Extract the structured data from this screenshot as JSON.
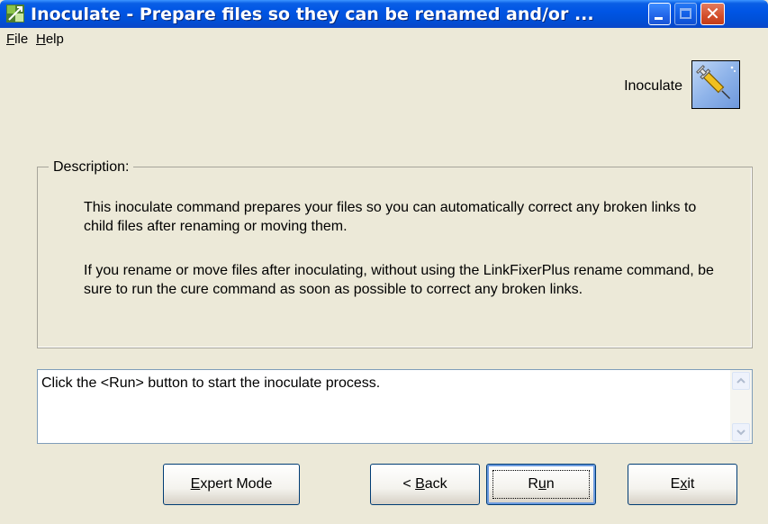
{
  "window": {
    "title": "Inoculate - Prepare files so they can be renamed and/or ...",
    "app_icon": "linkfixer-app-icon",
    "controls": [
      "minimize-icon",
      "maximize-icon",
      "close-icon"
    ],
    "close_glyph": "✕",
    "colors": {
      "titlebar": "#0055E5",
      "close": "#D34E2A",
      "face": "#ECE9D8"
    }
  },
  "menu": {
    "file": {
      "accel": "F",
      "rest": "ile"
    },
    "help": {
      "accel": "H",
      "rest": "elp"
    }
  },
  "header": {
    "label": "Inoculate",
    "icon": "syringe-icon"
  },
  "description": {
    "legend": "Description:",
    "paragraph1": "This inoculate command prepares your files so you can automatically correct any broken links to child files after renaming or moving them.",
    "paragraph2": "If you rename or move files after inoculating, without using the LinkFixerPlus rename command, be sure to run the cure command as soon as possible to correct any broken links."
  },
  "log": {
    "text": "Click the <Run> button to start the inoculate process."
  },
  "buttons": {
    "expert": {
      "accel": "E",
      "rest": "xpert Mode"
    },
    "back": {
      "prefix": "< ",
      "accel": "B",
      "rest": "ack"
    },
    "run": {
      "prefix": "R",
      "accel": "u",
      "rest": "n"
    },
    "exit": {
      "prefix": "E",
      "accel": "x",
      "rest": "it"
    }
  }
}
